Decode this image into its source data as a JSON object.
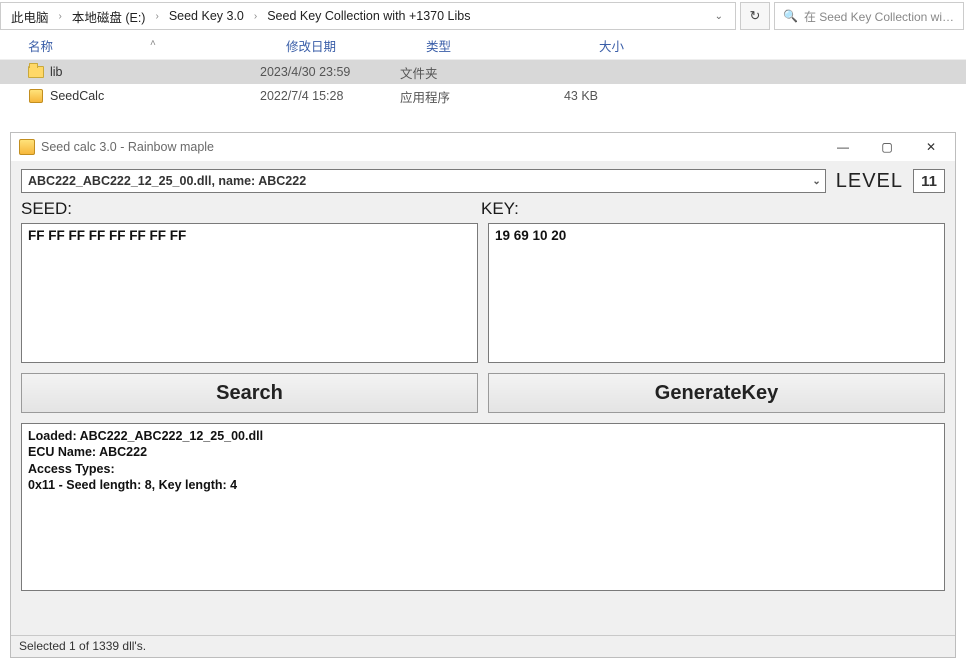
{
  "explorer": {
    "breadcrumbs": [
      "此电脑",
      "本地磁盘 (E:)",
      "Seed Key 3.0",
      "Seed Key Collection with +1370 Libs"
    ],
    "search_placeholder": "在 Seed Key Collection wit...",
    "columns": {
      "name": "名称",
      "date": "修改日期",
      "type": "类型",
      "size": "大小"
    },
    "rows": [
      {
        "icon": "folder",
        "name": "lib",
        "date": "2023/4/30 23:59",
        "type": "文件夹",
        "size": "",
        "selected": true
      },
      {
        "icon": "app",
        "name": "SeedCalc",
        "date": "2022/7/4 15:28",
        "type": "应用程序",
        "size": "43 KB",
        "selected": false
      }
    ]
  },
  "dialog": {
    "title": "Seed calc 3.0 - Rainbow maple",
    "dll_selected": "ABC222_ABC222_12_25_00.dll, name: ABC222",
    "level_label": "LEVEL",
    "level_value": "11",
    "seed_label": "SEED:",
    "key_label": "KEY:",
    "seed_value": "FF FF FF FF FF FF FF FF",
    "key_value": "19 69 10 20",
    "search_btn": "Search",
    "generate_btn": "GenerateKey",
    "log": "Loaded: ABC222_ABC222_12_25_00.dll\nECU Name: ABC222\nAccess Types:\n0x11 - Seed length: 8, Key length: 4",
    "status": "Selected 1 of 1339 dll's."
  }
}
